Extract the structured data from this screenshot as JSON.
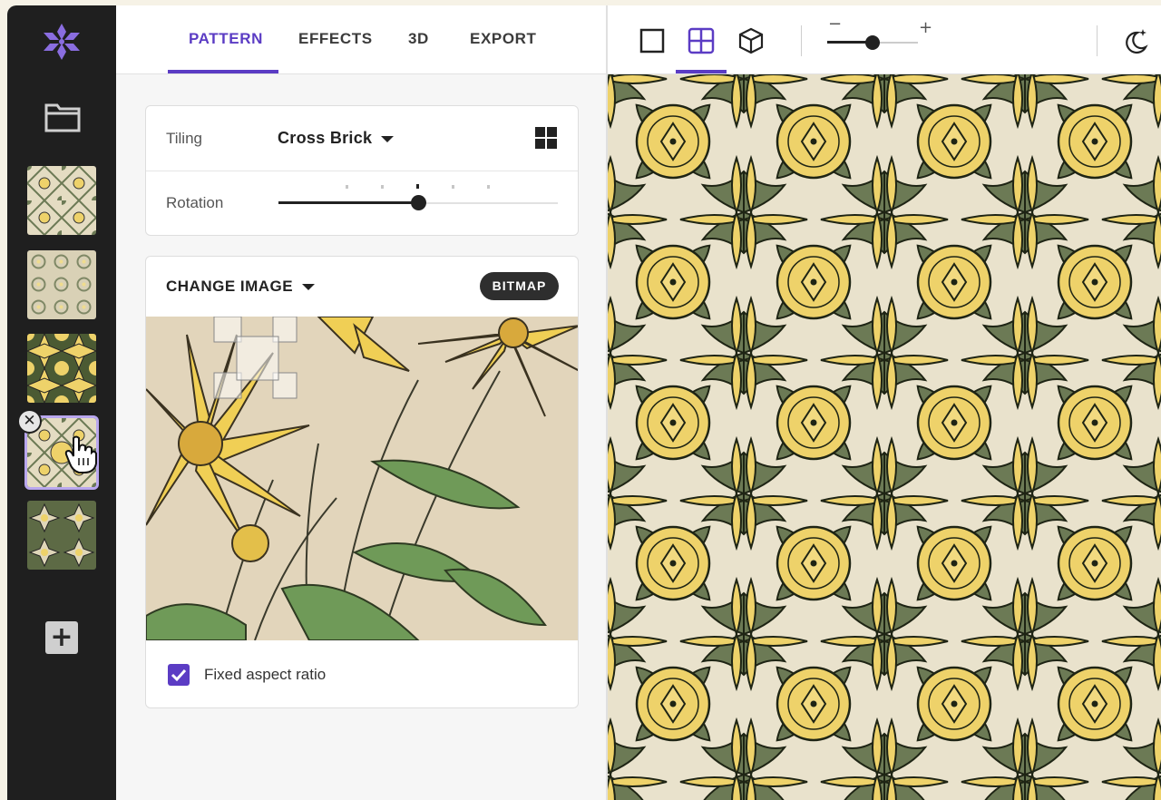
{
  "sidebar": {
    "logo_icon": "snowflake-logo-icon",
    "folder_icon": "folder-icon",
    "thumbnails": [
      {
        "name": "pattern-thumb-1",
        "selected": false
      },
      {
        "name": "pattern-thumb-2",
        "selected": false
      },
      {
        "name": "pattern-thumb-3",
        "selected": false
      },
      {
        "name": "pattern-thumb-4",
        "selected": true
      },
      {
        "name": "pattern-thumb-5",
        "selected": false
      }
    ],
    "close_label": "✕",
    "add_label": "+"
  },
  "tabs": [
    {
      "label": "PATTERN",
      "active": true
    },
    {
      "label": "EFFECTS",
      "active": false
    },
    {
      "label": "3D",
      "active": false
    },
    {
      "label": "EXPORT",
      "active": false
    }
  ],
  "tiling": {
    "label": "Tiling",
    "value": "Cross Brick",
    "grid_icon": "grid-icon"
  },
  "rotation": {
    "label": "Rotation",
    "value_fraction": 0.5,
    "tick_count": 5
  },
  "image": {
    "change_label": "CHANGE IMAGE",
    "badge": "BITMAP",
    "fixed_aspect_label": "Fixed aspect ratio",
    "fixed_aspect_checked": true
  },
  "canvas_toolbar": {
    "view_icons": [
      "single-tile-icon",
      "tiled-view-icon",
      "3d-cube-icon"
    ],
    "active_view": "tiled-view-icon",
    "zoom_minus": "−",
    "zoom_plus": "+",
    "zoom_fraction": 0.5,
    "theme_icon": "moon-stars-icon"
  },
  "colors": {
    "accent": "#5b3cc4",
    "sidebar_bg": "#1f1f1f",
    "pattern_green": "#6c7a55",
    "pattern_yellow": "#eed26a",
    "pattern_cream": "#e9e2cc"
  }
}
